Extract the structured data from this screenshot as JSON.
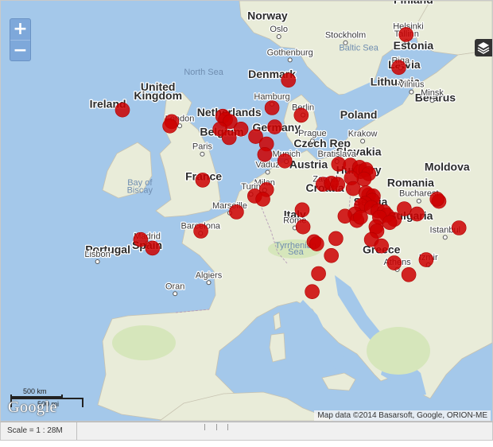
{
  "map": {
    "controls": {
      "zoom_in_label": "+",
      "zoom_out_label": "−"
    },
    "colors": {
      "water": "#a4c8ea",
      "land": "#e9ecd9",
      "marker": "#cc0000"
    },
    "countries": [
      {
        "name": "Norway",
        "lat": 61.5,
        "lon": 9.5
      },
      {
        "name": "Finland",
        "lat": 63.0,
        "lon": 25.5
      },
      {
        "name": "Estonia",
        "lat": 58.7,
        "lon": 25.5
      },
      {
        "name": "Latvia",
        "lat": 56.9,
        "lon": 24.5
      },
      {
        "name": "Lithuania",
        "lat": 55.3,
        "lon": 23.5
      },
      {
        "name": "Belarus",
        "lat": 53.8,
        "lon": 27.9
      },
      {
        "name": "Denmark",
        "lat": 56.0,
        "lon": 10.0
      },
      {
        "name": "United",
        "lat": 54.8,
        "lon": -2.5
      },
      {
        "name": "Kingdom",
        "lat": 54.0,
        "lon": -2.5
      },
      {
        "name": "Ireland",
        "lat": 53.2,
        "lon": -8.0
      },
      {
        "name": "Poland",
        "lat": 52.2,
        "lon": 19.5
      },
      {
        "name": "Germany",
        "lat": 51.0,
        "lon": 10.5
      },
      {
        "name": "Czech Rep",
        "lat": 49.5,
        "lon": 15.5
      },
      {
        "name": "Slovakia",
        "lat": 48.7,
        "lon": 19.5
      },
      {
        "name": "Austria",
        "lat": 47.5,
        "lon": 14.0
      },
      {
        "name": "Hungary",
        "lat": 47.0,
        "lon": 19.5
      },
      {
        "name": "Moldova",
        "lat": 47.3,
        "lon": 29.2
      },
      {
        "name": "Romania",
        "lat": 45.8,
        "lon": 25.2
      },
      {
        "name": "France",
        "lat": 46.4,
        "lon": 2.5
      },
      {
        "name": "Croatia",
        "lat": 45.3,
        "lon": 15.8
      },
      {
        "name": "Serbia",
        "lat": 44.0,
        "lon": 20.8
      },
      {
        "name": "Italy",
        "lat": 42.8,
        "lon": 12.5
      },
      {
        "name": "Bulgaria",
        "lat": 42.7,
        "lon": 25.2
      },
      {
        "name": "Portugal",
        "lat": 39.5,
        "lon": -8.0
      },
      {
        "name": "Spain",
        "lat": 39.9,
        "lon": -3.7
      },
      {
        "name": "Greece",
        "lat": 39.5,
        "lon": 22.0
      },
      {
        "name": "Belgium",
        "lat": 50.6,
        "lon": 4.5
      },
      {
        "name": "Netherlands",
        "lat": 52.4,
        "lon": 5.3
      }
    ],
    "cities": [
      {
        "name": "Oslo",
        "lat": 59.9,
        "lon": 10.75
      },
      {
        "name": "Helsinki",
        "lat": 60.17,
        "lon": 24.94
      },
      {
        "name": "Tallinn",
        "lat": 59.44,
        "lon": 24.75
      },
      {
        "name": "Stockholm",
        "lat": 59.33,
        "lon": 18.06
      },
      {
        "name": "Gothenburg",
        "lat": 57.7,
        "lon": 11.97
      },
      {
        "name": "Riga",
        "lat": 56.95,
        "lon": 24.1
      },
      {
        "name": "Vilnius",
        "lat": 54.69,
        "lon": 25.28
      },
      {
        "name": "Minsk",
        "lat": 53.9,
        "lon": 27.56
      },
      {
        "name": "Hamburg",
        "lat": 53.55,
        "lon": 9.99
      },
      {
        "name": "Berlin",
        "lat": 52.52,
        "lon": 13.4
      },
      {
        "name": "London",
        "lat": 51.5,
        "lon": -0.12
      },
      {
        "name": "Prague",
        "lat": 50.08,
        "lon": 14.43
      },
      {
        "name": "Krakow",
        "lat": 50.06,
        "lon": 19.94
      },
      {
        "name": "Paris",
        "lat": 48.85,
        "lon": 2.35
      },
      {
        "name": "Munich",
        "lat": 48.14,
        "lon": 11.58
      },
      {
        "name": "Bratislava",
        "lat": 48.15,
        "lon": 17.11
      },
      {
        "name": "Vaduz",
        "lat": 47.14,
        "lon": 9.52
      },
      {
        "name": "Zagreb",
        "lat": 45.81,
        "lon": 15.98
      },
      {
        "name": "Milan",
        "lat": 45.46,
        "lon": 9.19
      },
      {
        "name": "Turin",
        "lat": 45.07,
        "lon": 7.69
      },
      {
        "name": "Marseille",
        "lat": 43.3,
        "lon": 5.37
      },
      {
        "name": "Barcelona",
        "lat": 41.39,
        "lon": 2.17
      },
      {
        "name": "Rome",
        "lat": 41.9,
        "lon": 12.5
      },
      {
        "name": "Madrid",
        "lat": 40.42,
        "lon": -3.7
      },
      {
        "name": "Lisbon",
        "lat": 38.72,
        "lon": -9.14
      },
      {
        "name": "Athens",
        "lat": 37.98,
        "lon": 23.73
      },
      {
        "name": "Izmir",
        "lat": 38.42,
        "lon": 27.14
      },
      {
        "name": "Istanbul",
        "lat": 41.01,
        "lon": 28.98
      },
      {
        "name": "Bucharest",
        "lat": 44.43,
        "lon": 26.1
      },
      {
        "name": "Algiers",
        "lat": 36.75,
        "lon": 3.06
      },
      {
        "name": "Oran",
        "lat": 35.7,
        "lon": -0.63
      }
    ],
    "seas": [
      {
        "name": "North Sea",
        "lat": 56.3,
        "lon": 2.5
      },
      {
        "name": "Baltic Sea",
        "lat": 58.6,
        "lon": 19.5
      },
      {
        "name": "Bay of",
        "lat": 45.9,
        "lon": -4.5
      },
      {
        "name": "Biscay",
        "lat": 45.2,
        "lon": -4.5
      },
      {
        "name": "Tyrrhenian",
        "lat": 40.0,
        "lon": 12.6
      },
      {
        "name": "Sea",
        "lat": 39.4,
        "lon": 12.6
      }
    ],
    "markers": [
      {
        "lat": 60.1,
        "lon": 24.7
      },
      {
        "lat": 57.0,
        "lon": 23.9
      },
      {
        "lat": 55.8,
        "lon": 11.8
      },
      {
        "lat": 53.0,
        "lon": -6.4
      },
      {
        "lat": 51.9,
        "lon": -1.0
      },
      {
        "lat": 51.5,
        "lon": -1.2
      },
      {
        "lat": 52.4,
        "lon": 4.6
      },
      {
        "lat": 52.1,
        "lon": 4.9
      },
      {
        "lat": 51.9,
        "lon": 5.4
      },
      {
        "lat": 51.2,
        "lon": 4.3
      },
      {
        "lat": 50.5,
        "lon": 8.2
      },
      {
        "lat": 51.2,
        "lon": 6.6
      },
      {
        "lat": 53.2,
        "lon": 10.0
      },
      {
        "lat": 52.5,
        "lon": 13.2
      },
      {
        "lat": 51.4,
        "lon": 10.3
      },
      {
        "lat": 50.4,
        "lon": 5.3
      },
      {
        "lat": 49.8,
        "lon": 9.4
      },
      {
        "lat": 48.8,
        "lon": 9.2
      },
      {
        "lat": 48.2,
        "lon": 11.4
      },
      {
        "lat": 47.9,
        "lon": 17.3
      },
      {
        "lat": 47.8,
        "lon": 18.6
      },
      {
        "lat": 47.6,
        "lon": 19.6
      },
      {
        "lat": 47.2,
        "lon": 19.7
      },
      {
        "lat": 47.4,
        "lon": 20.3
      },
      {
        "lat": 47.0,
        "lon": 20.6
      },
      {
        "lat": 46.5,
        "lon": 20.1
      },
      {
        "lat": 46.6,
        "lon": 18.7
      },
      {
        "lat": 46.0,
        "lon": 15.6
      },
      {
        "lat": 46.1,
        "lon": 16.5
      },
      {
        "lat": 46.0,
        "lon": 17.2
      },
      {
        "lat": 45.6,
        "lon": 18.9
      },
      {
        "lat": 45.0,
        "lon": 20.6
      },
      {
        "lat": 45.2,
        "lon": 20.3
      },
      {
        "lat": 44.9,
        "lon": 21.1
      },
      {
        "lat": 44.5,
        "lon": 21.0
      },
      {
        "lat": 44.2,
        "lon": 20.2
      },
      {
        "lat": 44.0,
        "lon": 19.8
      },
      {
        "lat": 43.8,
        "lon": 20.9
      },
      {
        "lat": 43.5,
        "lon": 21.6
      },
      {
        "lat": 43.4,
        "lon": 22.3
      },
      {
        "lat": 43.1,
        "lon": 22.6
      },
      {
        "lat": 42.9,
        "lon": 21.8
      },
      {
        "lat": 42.7,
        "lon": 23.4
      },
      {
        "lat": 42.4,
        "lon": 22.9
      },
      {
        "lat": 42.0,
        "lon": 21.4
      },
      {
        "lat": 41.6,
        "lon": 21.5
      },
      {
        "lat": 43.2,
        "lon": 19.1
      },
      {
        "lat": 43.0,
        "lon": 18.0
      },
      {
        "lat": 42.6,
        "lon": 19.3
      },
      {
        "lat": 42.9,
        "lon": 19.7
      },
      {
        "lat": 43.7,
        "lon": 24.5
      },
      {
        "lat": 43.2,
        "lon": 25.9
      },
      {
        "lat": 44.4,
        "lon": 28.3
      },
      {
        "lat": 44.6,
        "lon": 28.1
      },
      {
        "lat": 41.9,
        "lon": 30.5
      },
      {
        "lat": 45.5,
        "lon": 9.4
      },
      {
        "lat": 44.9,
        "lon": 8.1
      },
      {
        "lat": 44.6,
        "lon": 9.0
      },
      {
        "lat": 43.4,
        "lon": 6.1
      },
      {
        "lat": 46.4,
        "lon": 2.4
      },
      {
        "lat": 41.6,
        "lon": 2.2
      },
      {
        "lat": 40.8,
        "lon": -4.4
      },
      {
        "lat": 40.0,
        "lon": -3.1
      },
      {
        "lat": 43.6,
        "lon": 13.3
      },
      {
        "lat": 42.0,
        "lon": 13.4
      },
      {
        "lat": 40.6,
        "lon": 14.6
      },
      {
        "lat": 40.4,
        "lon": 14.9
      },
      {
        "lat": 40.9,
        "lon": 17.0
      },
      {
        "lat": 39.3,
        "lon": 16.5
      },
      {
        "lat": 37.6,
        "lon": 15.1
      },
      {
        "lat": 40.8,
        "lon": 20.9
      },
      {
        "lat": 40.2,
        "lon": 22.0
      },
      {
        "lat": 38.6,
        "lon": 23.4
      },
      {
        "lat": 37.5,
        "lon": 25.0
      },
      {
        "lat": 38.9,
        "lon": 26.9
      },
      {
        "lat": 35.9,
        "lon": 14.4
      }
    ],
    "scale_bar": {
      "km_label": "500 km",
      "mi_label": "500 mi"
    },
    "google_logo": "Google",
    "attribution": "Map data ©2014 Basarsoft, Google, ORION-ME"
  },
  "status_bar": {
    "scale_text": "Scale = 1 : 28M"
  }
}
